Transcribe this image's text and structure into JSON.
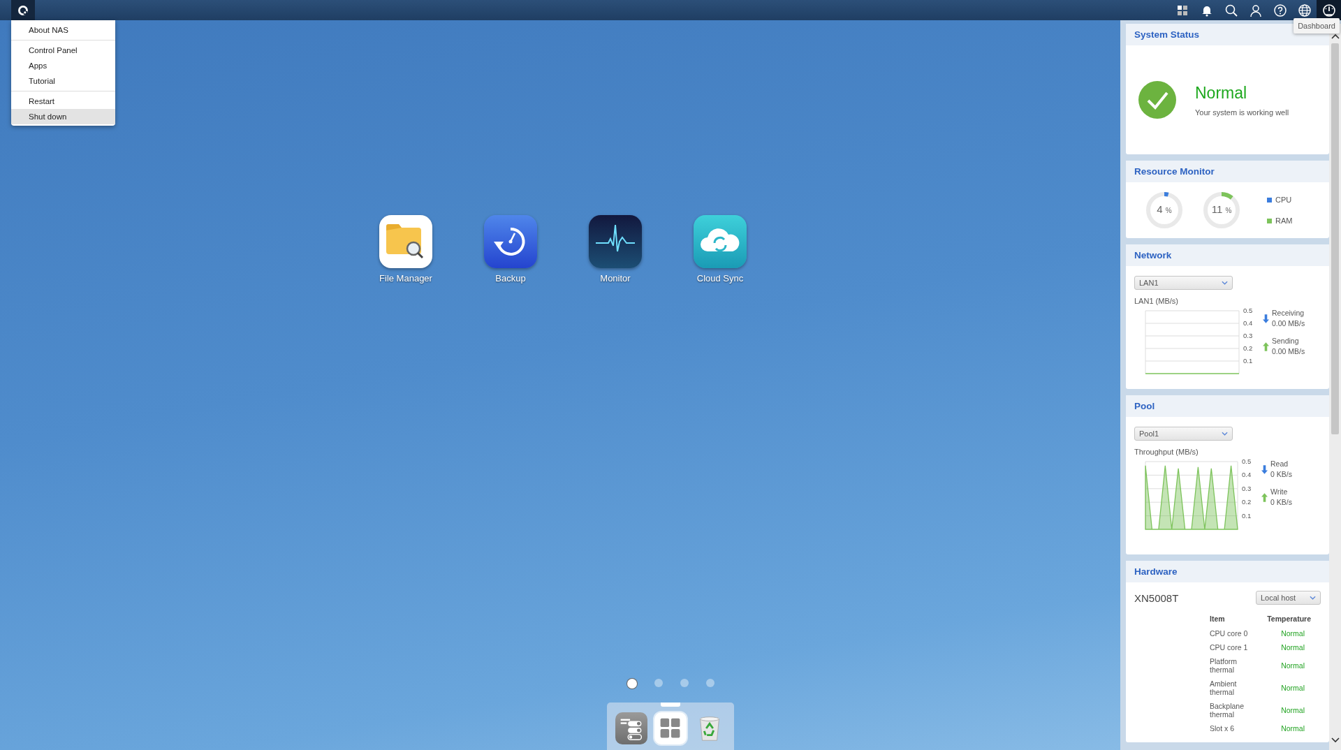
{
  "top_bar": {
    "icons": [
      {
        "kind": "apps",
        "selected": false
      },
      {
        "kind": "bell",
        "selected": false
      },
      {
        "kind": "search",
        "selected": false
      },
      {
        "kind": "user",
        "selected": false
      },
      {
        "kind": "help",
        "selected": false
      },
      {
        "kind": "globe",
        "selected": false
      },
      {
        "kind": "dashboard",
        "selected": true
      }
    ],
    "tooltip": "Dashboard"
  },
  "main_menu": {
    "items": [
      {
        "label": "About NAS",
        "selected": false,
        "separator_after": true
      },
      {
        "label": "Control Panel",
        "selected": false,
        "separator_after": false
      },
      {
        "label": "Apps",
        "selected": false,
        "separator_after": false
      },
      {
        "label": "Tutorial",
        "selected": false,
        "separator_after": true
      },
      {
        "label": "Restart",
        "selected": false,
        "separator_after": false
      },
      {
        "label": "Shut down",
        "selected": true,
        "separator_after": false
      }
    ]
  },
  "desktop": {
    "apps": [
      {
        "label": "File Manager",
        "kind": "files"
      },
      {
        "label": "Backup",
        "kind": "backup"
      },
      {
        "label": "Monitor",
        "kind": "monitor"
      },
      {
        "label": "Cloud Sync",
        "kind": "cloud"
      }
    ],
    "page_dots": [
      {
        "selected": true
      },
      {
        "selected": false
      },
      {
        "selected": false
      },
      {
        "selected": false
      }
    ]
  },
  "dock": {
    "items": [
      {
        "kind": "settings",
        "selected": false
      },
      {
        "kind": "apps",
        "selected": true
      },
      {
        "kind": "recycle",
        "selected": false
      }
    ]
  },
  "dashboard": {
    "system_status": {
      "title": "System Status",
      "status": "Normal",
      "message": "Your system is working well"
    },
    "resource_monitor": {
      "title": "Resource Monitor",
      "gauges": [
        {
          "value": "4",
          "unit": "%",
          "level": 0.04,
          "color": "#3b7ddd"
        },
        {
          "value": "11",
          "unit": "%",
          "level": 0.11,
          "color": "#7dc35b"
        }
      ],
      "legend": [
        {
          "label": "CPU",
          "color": "#3b7ddd"
        },
        {
          "label": "RAM",
          "color": "#7dc35b"
        }
      ]
    },
    "network": {
      "title": "Network",
      "selector": "LAN1",
      "chart_label": "LAN1 (MB/s)",
      "chart_data": {
        "type": "line",
        "series": [
          {
            "color": "#7dc35b",
            "values": [
              0,
              0,
              0,
              0,
              0,
              0,
              0,
              0,
              0,
              0,
              0,
              0,
              0,
              0,
              0
            ]
          }
        ],
        "ylim": [
          0,
          0.5
        ],
        "yticks": [
          0.1,
          0.2,
          0.3,
          0.4,
          0.5
        ],
        "grid": true
      },
      "stats": [
        {
          "kind": "down",
          "label": "Receiving",
          "value": "0.00 MB/s"
        },
        {
          "kind": "up",
          "label": "Sending",
          "value": "0.00 MB/s"
        }
      ]
    },
    "pool": {
      "title": "Pool",
      "selector": "Pool1",
      "chart_label": "Throughput (MB/s)",
      "chart_data": {
        "type": "area",
        "series": [
          {
            "color": "#7dc35b",
            "values": [
              0.47,
              0,
              0,
              0.47,
              0,
              0.45,
              0,
              0,
              0.46,
              0,
              0.45,
              0,
              0,
              0.47,
              0
            ]
          }
        ],
        "ylim": [
          0,
          0.5
        ],
        "yticks": [
          0.1,
          0.2,
          0.3,
          0.4,
          0.5
        ],
        "grid": true
      },
      "stats": [
        {
          "kind": "down",
          "label": "Read",
          "value": "0 KB/s"
        },
        {
          "kind": "up",
          "label": "Write",
          "value": "0 KB/s"
        }
      ]
    },
    "hardware": {
      "title": "Hardware",
      "model": "XN5008T",
      "selector": "Local host",
      "columns": [
        "Item",
        "Temperature"
      ],
      "rows": [
        {
          "item": "CPU core 0",
          "temperature": "Normal"
        },
        {
          "item": "CPU core 1",
          "temperature": "Normal"
        },
        {
          "item": "Platform thermal",
          "temperature": "Normal"
        },
        {
          "item": "Ambient thermal",
          "temperature": "Normal"
        },
        {
          "item": "Backplane thermal",
          "temperature": "Normal"
        },
        {
          "item": "Slot x 6",
          "temperature": "Normal"
        }
      ]
    }
  }
}
